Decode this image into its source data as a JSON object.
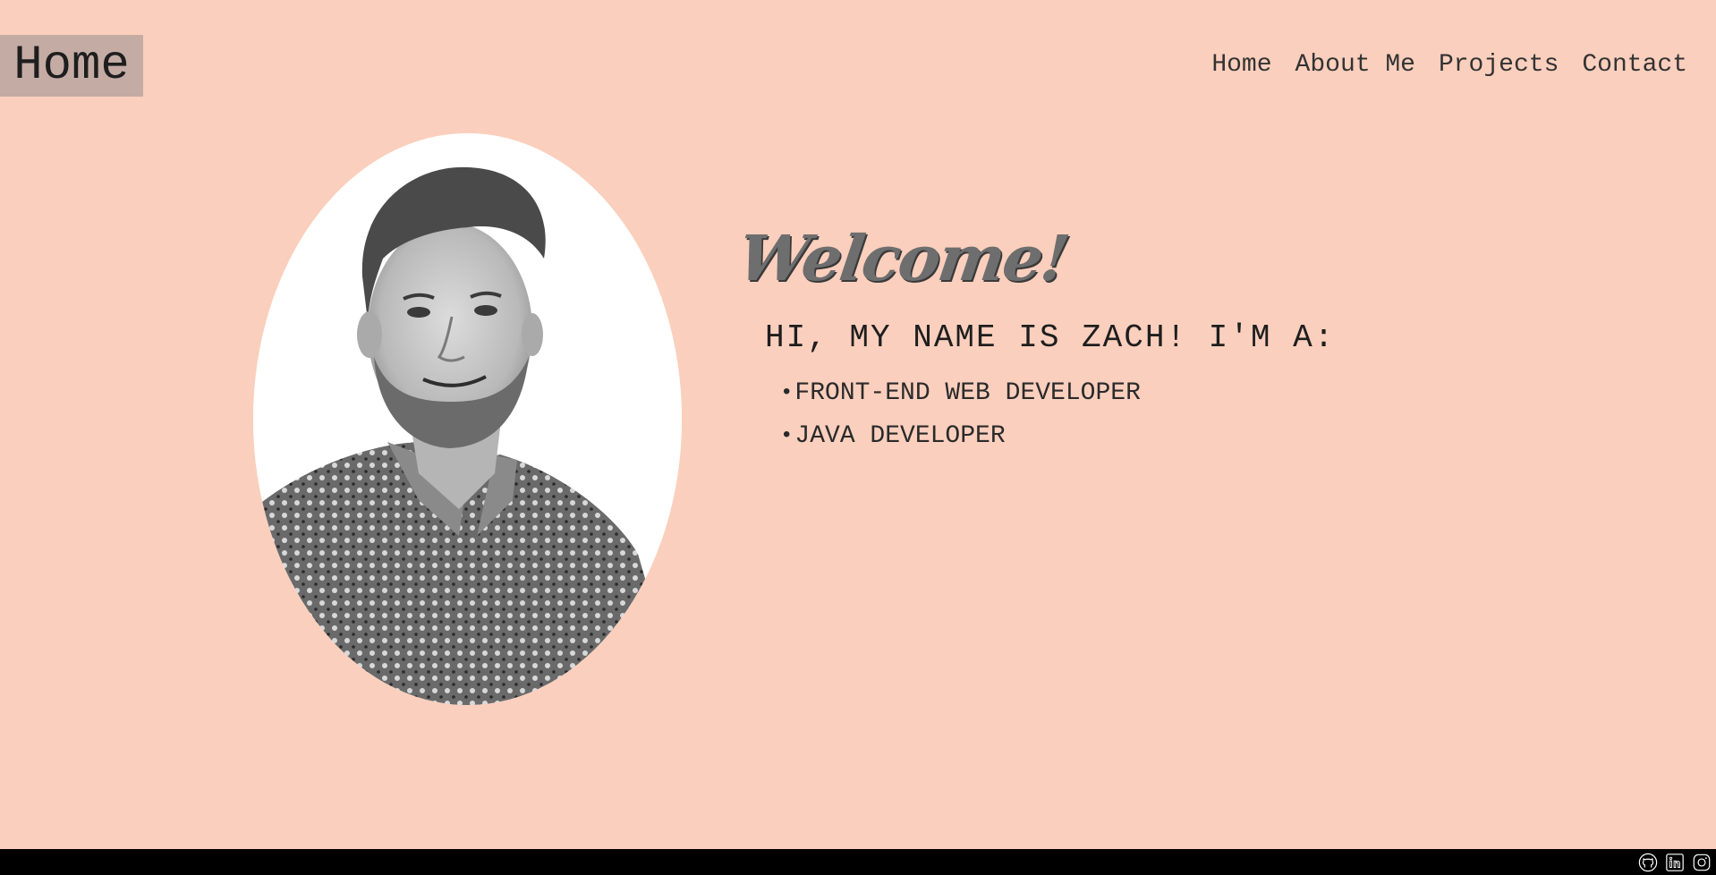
{
  "header": {
    "brand_label": "Home",
    "nav": [
      {
        "label": "Home"
      },
      {
        "label": "About Me"
      },
      {
        "label": "Projects"
      },
      {
        "label": "Contact"
      }
    ]
  },
  "hero": {
    "welcome": "Welcome!",
    "intro": "HI, MY NAME IS ZACH! I'M A:",
    "bullet_char": "•",
    "roles": [
      {
        "label": "FRONT-END WEB DEVELOPER"
      },
      {
        "label": "JAVA DEVELOPER"
      }
    ],
    "portrait_icon": "profile-photo-oval"
  },
  "footer": {
    "icons": [
      "github-icon",
      "linkedin-icon",
      "instagram-icon"
    ]
  },
  "colors": {
    "background": "#fbcfbd",
    "brand_box": "#c4aca4",
    "footer": "#000000",
    "welcome_text": "#6e6e6e"
  }
}
